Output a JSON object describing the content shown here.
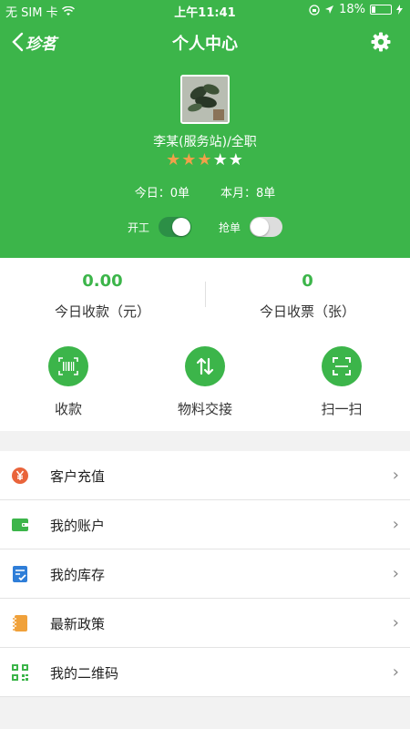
{
  "status_bar": {
    "carrier": "无 SIM 卡",
    "time": "上午11:41",
    "battery": "18%",
    "battery_level": 0.18
  },
  "nav": {
    "logo": "珍茗",
    "title": "个人中心"
  },
  "profile": {
    "name": "李某(服务站)/全职",
    "rating": 3,
    "rating_max": 5,
    "today": "今日：0单",
    "month": "本月：8单"
  },
  "toggles": [
    {
      "label": "开工",
      "on": true
    },
    {
      "label": "抢单",
      "on": false
    }
  ],
  "stats": {
    "receipts_value": "0.00",
    "receipts_label": "今日收款（元）",
    "tickets_value": "0",
    "tickets_label": "今日收票（张）"
  },
  "actions": [
    {
      "label": "收款",
      "icon": "barcode-icon"
    },
    {
      "label": "物料交接",
      "icon": "swap-arrows-icon"
    },
    {
      "label": "扫一扫",
      "icon": "scan-icon"
    }
  ],
  "menu": [
    {
      "label": "客户充值",
      "icon": "yuan-coin-icon",
      "color": "#e9643b"
    },
    {
      "label": "我的账户",
      "icon": "wallet-icon",
      "color": "#3cb54a"
    },
    {
      "label": "我的库存",
      "icon": "checklist-icon",
      "color": "#2f7ed8"
    },
    {
      "label": "最新政策",
      "icon": "notebook-icon",
      "color": "#f0a13a"
    },
    {
      "label": "我的二维码",
      "icon": "qrcode-icon",
      "color": "#3cb54a"
    }
  ],
  "colors": {
    "primary_green": "#3cb54a",
    "star_active": "#f1a04a"
  }
}
